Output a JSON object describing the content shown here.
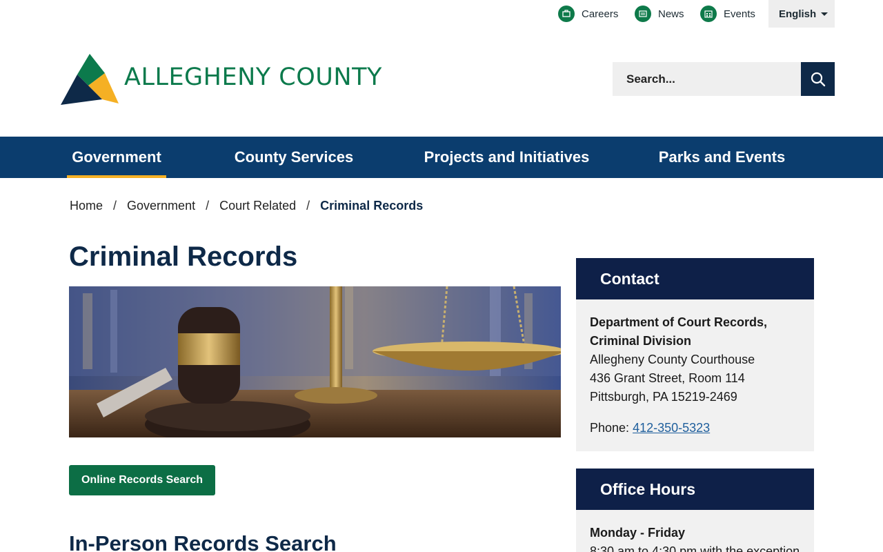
{
  "utility": {
    "links": [
      {
        "label": "Careers",
        "icon": "briefcase-icon"
      },
      {
        "label": "News",
        "icon": "newspaper-icon"
      },
      {
        "label": "Events",
        "icon": "calendar-icon"
      }
    ],
    "language": "English"
  },
  "logo": {
    "text": "ALLEGHENY COUNTY",
    "colors": [
      "#0c7a4c",
      "#f5b024",
      "#0e2948"
    ]
  },
  "search": {
    "placeholder": "Search..."
  },
  "nav": {
    "items": [
      {
        "label": "Government",
        "active": true
      },
      {
        "label": "County Services"
      },
      {
        "label": "Projects and Initiatives"
      },
      {
        "label": "Parks and Events"
      }
    ]
  },
  "breadcrumb": {
    "items": [
      "Home",
      "Government",
      "Court Related"
    ],
    "current": "Criminal Records"
  },
  "main": {
    "title": "Criminal Records",
    "hero_alt": "Gavel and scales of justice",
    "button_label": "Online Records Search",
    "section_heading": "In-Person Records Search"
  },
  "sidebar": {
    "contact": {
      "heading": "Contact",
      "org_line1": "Department of Court Records,",
      "org_line2": "Criminal Division",
      "address1": "Allegheny County Courthouse",
      "address2": "436 Grant Street, Room 114",
      "address3": "Pittsburgh, PA 15219-2469",
      "phone_label": "Phone: ",
      "phone": "412-350-5323"
    },
    "hours": {
      "heading": "Office Hours",
      "days": "Monday - Friday",
      "time": "8:30 am to 4:30 pm with the exception"
    }
  },
  "colors": {
    "nav": "#0b3d6e",
    "accent": "#f5b024",
    "green": "#0c6e45",
    "navy": "#0e2948"
  }
}
